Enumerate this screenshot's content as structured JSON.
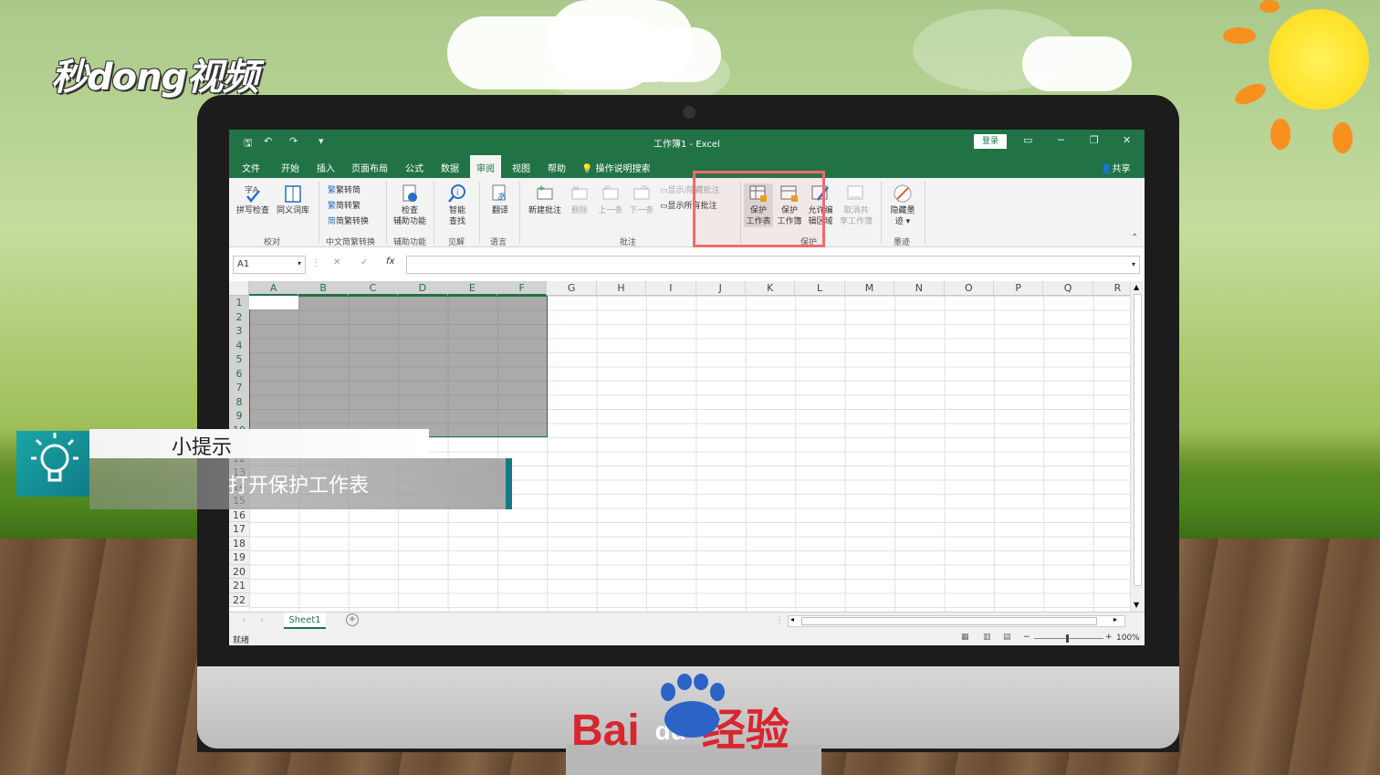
{
  "watermark": {
    "logo_text": "秒dong视频",
    "baidu_text": "Bai",
    "baidu_du": "du",
    "baidu_suffix": "经验"
  },
  "window": {
    "title": "工作簿1 - Excel",
    "login_label": "登录"
  },
  "quick_access": {
    "save": "🖫",
    "undo": "↶",
    "redo": "↷",
    "more": "▾"
  },
  "menu": {
    "items": [
      "文件",
      "开始",
      "插入",
      "页面布局",
      "公式",
      "数据",
      "审阅",
      "视图",
      "帮助"
    ],
    "search_label": "操作说明搜索",
    "share_label": "共享"
  },
  "ribbon": {
    "proofing": {
      "spell": "拼写检查",
      "thesaurus": "同义词库",
      "label": "校对"
    },
    "chinese": {
      "t2s": "繁转简",
      "s2t": "简转繁",
      "convert": "简繁转换",
      "label": "中文简繁转换"
    },
    "accessibility": {
      "check_l1": "检查",
      "check_l2": "辅助功能",
      "label": "辅助功能"
    },
    "insights": {
      "smart_l1": "智能",
      "smart_l2": "查找",
      "label": "见解"
    },
    "language": {
      "translate": "翻译",
      "label": "语言"
    },
    "comments": {
      "new": "新建批注",
      "delete": "删除",
      "prev": "上一条",
      "next": "下一条",
      "show_hide": "显示/隐藏批注",
      "show_all": "显示所有批注",
      "label": "批注"
    },
    "protect": {
      "sheet_l1": "保护",
      "sheet_l2": "工作表",
      "book_l1": "保护",
      "book_l2": "工作簿",
      "allow_l1": "允许编",
      "allow_l2": "辑区域",
      "unshare_l1": "取消共",
      "unshare_l2": "享工作簿",
      "label": "保护"
    },
    "ink": {
      "hide_l1": "隐藏墨",
      "hide_l2": "迹 ▾",
      "label": "墨迹"
    }
  },
  "formula_bar": {
    "name_box": "A1",
    "cancel": "✕",
    "enter": "✓",
    "fx": "fx"
  },
  "columns": [
    "A",
    "B",
    "C",
    "D",
    "E",
    "F",
    "G",
    "H",
    "I",
    "J",
    "K",
    "L",
    "M",
    "N",
    "O",
    "P",
    "Q",
    "R"
  ],
  "rows": [
    "1",
    "2",
    "3",
    "4",
    "5",
    "6",
    "7",
    "8",
    "9",
    "10",
    "11",
    "12",
    "13",
    "14",
    "15",
    "16",
    "17",
    "18",
    "19",
    "20",
    "21",
    "22"
  ],
  "sheet_tab": "Sheet1",
  "status": {
    "ready": "就绪",
    "zoom": "100%"
  },
  "tip": {
    "title": "小提示",
    "body": "打开保护工作表"
  },
  "colors": {
    "excel_green": "#217346",
    "highlight_red": "#ef6b6b",
    "tip_teal": "#0f7c86"
  }
}
